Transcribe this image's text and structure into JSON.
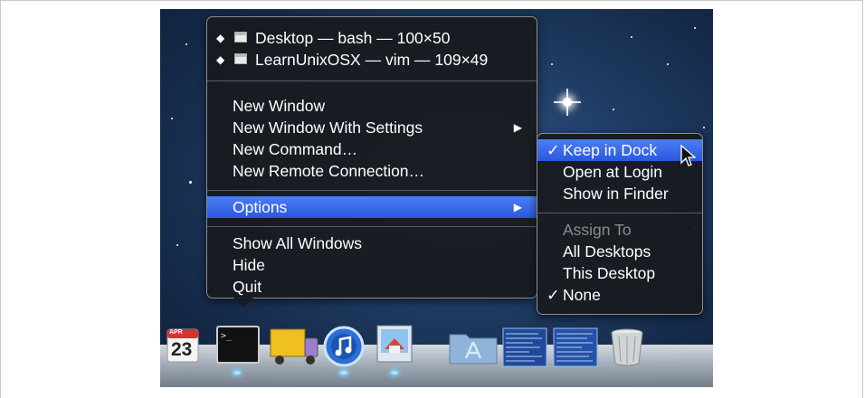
{
  "main_menu": {
    "windows": [
      {
        "bullet": "◆",
        "label": "Desktop — bash — 100×50"
      },
      {
        "bullet": "◆",
        "label": "LearnUnixOSX — vim — 109×49"
      }
    ],
    "items": [
      {
        "label": "New Window"
      },
      {
        "label": "New Window With Settings",
        "submenu": "▶"
      },
      {
        "label": "New Command…"
      },
      {
        "label": "New Remote Connection…"
      }
    ],
    "options": {
      "label": "Options",
      "submenu": "▶"
    },
    "bottom_items": [
      {
        "label": "Show All Windows"
      },
      {
        "label": "Hide"
      },
      {
        "label": "Quit"
      }
    ]
  },
  "options_menu": {
    "items": [
      {
        "check": "✓",
        "label": "Keep in Dock",
        "highlighted": true
      },
      {
        "check": "",
        "label": "Open at Login"
      },
      {
        "check": "",
        "label": "Show in Finder"
      }
    ],
    "assign_header": "Assign To",
    "assign_items": [
      {
        "check": "",
        "label": "All Desktops"
      },
      {
        "check": "",
        "label": "This Desktop"
      },
      {
        "check": "✓",
        "label": "None"
      }
    ]
  },
  "dock": {
    "calendar": {
      "month": "APR",
      "day": "23"
    },
    "icons": [
      "calendar-icon",
      "terminal-icon",
      "transmit-truck-icon",
      "itunes-icon",
      "preview-icon",
      "applications-folder-icon",
      "window-thumbnail-icon",
      "window-thumbnail-icon",
      "trash-icon"
    ]
  },
  "colors": {
    "highlight": "#3b6ae8",
    "menu_bg": "#1a1c20"
  }
}
